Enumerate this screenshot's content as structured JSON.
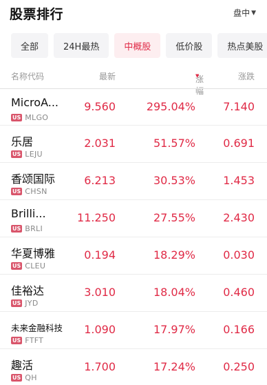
{
  "header": {
    "title": "股票排行",
    "status_label": "盘中",
    "caret": "▼"
  },
  "tabs": [
    {
      "label": "全部",
      "active": false
    },
    {
      "label": "24H最热",
      "active": false
    },
    {
      "label": "中概股",
      "active": true
    },
    {
      "label": "低价股",
      "active": false
    },
    {
      "label": "热点美股",
      "active": false
    }
  ],
  "columns": {
    "name": "名称代码",
    "price": "最新",
    "pct": "涨幅",
    "pct_sort_icon": "▼",
    "chg": "涨跌"
  },
  "rows": [
    {
      "name": "MicroA...",
      "market": "US",
      "code": "MLGO",
      "price": "9.560",
      "pct": "295.04%",
      "chg": "7.140"
    },
    {
      "name": "乐居",
      "market": "US",
      "code": "LEJU",
      "price": "2.031",
      "pct": "51.57%",
      "chg": "0.691"
    },
    {
      "name": "香颂国际",
      "market": "US",
      "code": "CHSN",
      "price": "6.213",
      "pct": "30.53%",
      "chg": "1.453"
    },
    {
      "name": "Brilli...",
      "market": "US",
      "code": "BRLI",
      "price": "11.250",
      "pct": "27.55%",
      "chg": "2.430"
    },
    {
      "name": "华夏博雅",
      "market": "US",
      "code": "CLEU",
      "price": "0.194",
      "pct": "18.29%",
      "chg": "0.030"
    },
    {
      "name": "佳裕达",
      "market": "US",
      "code": "JYD",
      "price": "3.010",
      "pct": "18.04%",
      "chg": "0.460"
    },
    {
      "name": "未来金融科技",
      "market": "US",
      "code": "FTFT",
      "price": "1.090",
      "pct": "17.97%",
      "chg": "0.166"
    },
    {
      "name": "趣活",
      "market": "US",
      "code": "QH",
      "price": "1.700",
      "pct": "17.24%",
      "chg": "0.250"
    }
  ],
  "colors": {
    "up": "#e02a46",
    "active_tab_bg": "#fdeef0",
    "tab_bg": "#f4f4f6",
    "market_badge": "#d9556b"
  }
}
